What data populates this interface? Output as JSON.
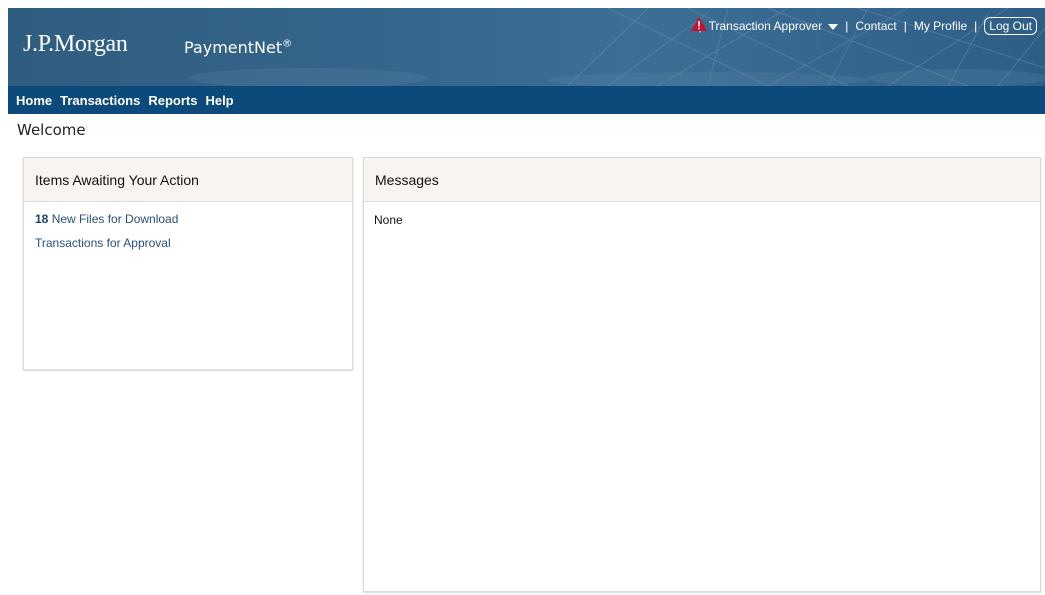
{
  "header": {
    "logo": "J.P.Morgan",
    "product": "PaymentNet",
    "product_mark": "®",
    "role": "Transaction Approver",
    "contact": "Contact",
    "profile": "My Profile",
    "logout": "Log Out",
    "alert_icon": "warning-triangle-icon"
  },
  "nav": {
    "items": [
      "Home",
      "Transactions",
      "Reports",
      "Help"
    ]
  },
  "page": {
    "title": "Welcome"
  },
  "actions_panel": {
    "title": "Items Awaiting Your Action",
    "files_count": "18",
    "files_label": " New Files for Download",
    "approval_label": "Transactions for Approval"
  },
  "messages_panel": {
    "title": "Messages",
    "body": "None"
  },
  "colors": {
    "banner": "#35658a",
    "nav": "#0b4a7a",
    "link": "#2a4f7d",
    "alert": "#c8102e"
  }
}
